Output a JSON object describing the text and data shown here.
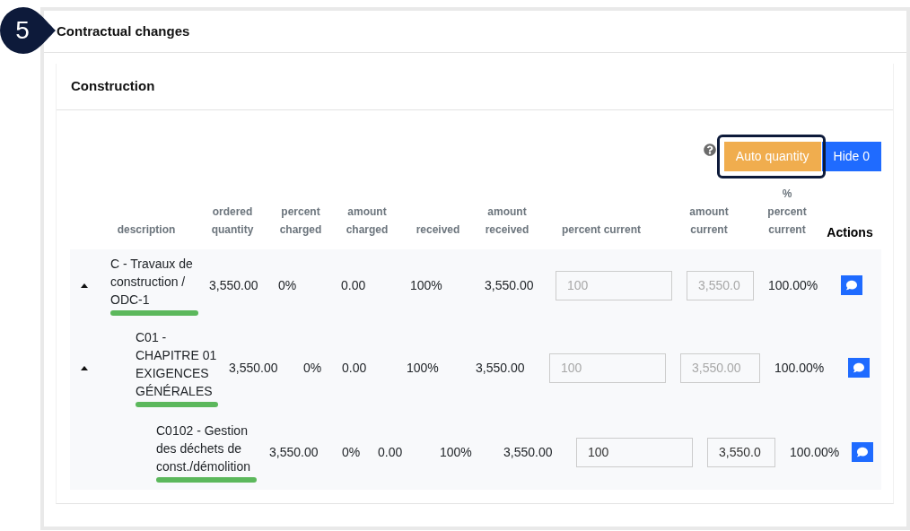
{
  "step_badge": "5",
  "panel": {
    "title": "Contractual changes"
  },
  "section": {
    "title": "Construction"
  },
  "toolbar": {
    "buttons": [
      {
        "label": "Auto quantity",
        "kind": "warning",
        "highlighted": true
      },
      {
        "label": "Hide 0",
        "kind": "primary",
        "highlighted": false
      }
    ]
  },
  "table": {
    "columns": [
      {
        "label": "description",
        "kind": "data"
      },
      {
        "label": "ordered quantity",
        "kind": "data"
      },
      {
        "label": "percent charged",
        "kind": "data"
      },
      {
        "label": "amount charged",
        "kind": "data"
      },
      {
        "label": "received",
        "kind": "data"
      },
      {
        "label": "amount received",
        "kind": "data"
      },
      {
        "label": "percent current",
        "kind": "data"
      },
      {
        "label": "amount current",
        "kind": "data"
      },
      {
        "label": "% percent current",
        "kind": "data"
      },
      {
        "label": "Actions",
        "kind": "action"
      }
    ],
    "rows": [
      {
        "description": "C - Travaux de construction / ODC-1",
        "expanded": true,
        "ordered_quantity": "3,550.00",
        "percent_charged": "0%",
        "amount_charged": "0.00",
        "received": "100%",
        "amount_received": "3,550.00",
        "percent_current": {
          "value": "100",
          "disabled": true
        },
        "amount_current": {
          "value": "3,550.0",
          "disabled": true
        },
        "percent_percent_current": "100.00%",
        "children": [
          {
            "description": "C01 - CHAPITRE 01 EXIGENCES GÉNÉRALES",
            "expanded": true,
            "ordered_quantity": "3,550.00",
            "percent_charged": "0%",
            "amount_charged": "0.00",
            "received": "100%",
            "amount_received": "3,550.00",
            "percent_current": {
              "value": "100",
              "disabled": true
            },
            "amount_current": {
              "value": "3,550.00",
              "disabled": true
            },
            "percent_percent_current": "100.00%",
            "children": [
              {
                "description": "C0102 - Gestion des déchets de const./démolition",
                "ordered_quantity": "3,550.00",
                "percent_charged": "0%",
                "amount_charged": "0.00",
                "received": "100%",
                "amount_received": "3,550.00",
                "percent_current": {
                  "value": "100",
                  "disabled": false
                },
                "amount_current": {
                  "value": "3,550.0",
                  "disabled": false
                },
                "percent_percent_current": "100.00%"
              }
            ]
          }
        ]
      }
    ]
  }
}
